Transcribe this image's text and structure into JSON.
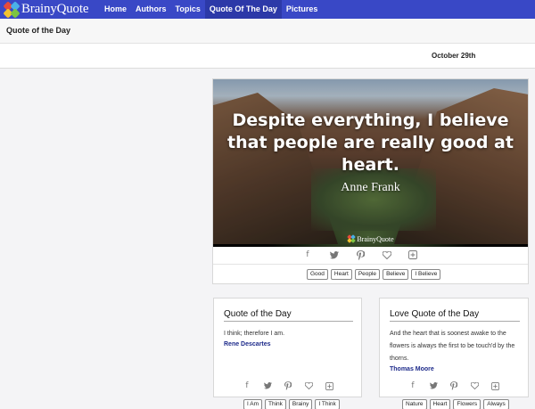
{
  "nav": {
    "logo_text": "BrainyQuote",
    "items": [
      {
        "label": "Home",
        "active": false
      },
      {
        "label": "Authors",
        "active": false
      },
      {
        "label": "Topics",
        "active": false
      },
      {
        "label": "Quote Of The Day",
        "active": true
      },
      {
        "label": "Pictures",
        "active": false
      }
    ]
  },
  "header": {
    "title": "Quote of the Day",
    "date": "October 29th"
  },
  "featured": {
    "quote": "Despite everything, I believe that people are really good at heart.",
    "author": "Anne Frank",
    "brand": "BrainyQuote",
    "share_icons": [
      "facebook-icon",
      "twitter-icon",
      "pinterest-icon",
      "heart-icon",
      "plus-box-icon"
    ],
    "tags": [
      "Good",
      "Heart",
      "People",
      "Believe",
      "I Believe"
    ]
  },
  "cards": [
    {
      "title": "Quote of the Day",
      "quote": "I think; therefore I am.",
      "author": "Rene Descartes",
      "tags": [
        "I Am",
        "Think",
        "Brainy",
        "I Think"
      ]
    },
    {
      "title": "Love Quote of the Day",
      "quote": "And the heart that is soonest awake to the flowers is always the first to be touch'd by the thorns.",
      "author": "Thomas Moore",
      "tags": [
        "Nature",
        "Heart",
        "Flowers",
        "Always"
      ]
    }
  ],
  "colors": {
    "nav_bg": "#3948c6",
    "nav_active": "#2c39a8",
    "author_link": "#1d2a8a"
  }
}
